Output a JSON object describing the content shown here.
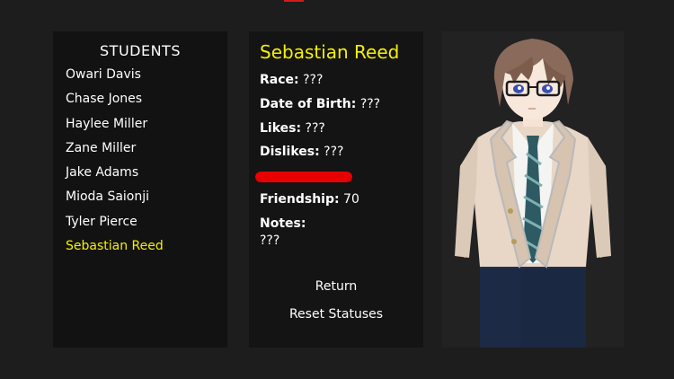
{
  "students": {
    "title": "STUDENTS",
    "items": [
      {
        "label": "Owari Davis",
        "selected": false
      },
      {
        "label": "Chase Jones",
        "selected": false
      },
      {
        "label": "Haylee Miller",
        "selected": false
      },
      {
        "label": "Zane Miller",
        "selected": false
      },
      {
        "label": "Jake Adams",
        "selected": false
      },
      {
        "label": "Mioda Saionji",
        "selected": false
      },
      {
        "label": "Tyler Pierce",
        "selected": false
      },
      {
        "label": "Sebastian Reed",
        "selected": true
      }
    ]
  },
  "details": {
    "name": "Sebastian Reed",
    "race_label": "Race:",
    "race_value": "???",
    "dob_label": "Date of Birth:",
    "dob_value": "???",
    "likes_label": "Likes:",
    "likes_value": "???",
    "dislikes_label": "Dislikes:",
    "dislikes_value": "???",
    "status_bar_fraction": 1.0,
    "status_bar_color": "#e80000",
    "friendship_label": "Friendship:",
    "friendship_value": "70",
    "notes_label": "Notes:",
    "notes_value": "???"
  },
  "buttons": {
    "return_label": "Return",
    "reset_label": "Reset Statuses"
  },
  "colors": {
    "selected_text": "#f5f000",
    "name_text": "#f5f000",
    "accent_red": "#d41a1a"
  },
  "portrait": {
    "icon": "student-portrait-icon"
  }
}
